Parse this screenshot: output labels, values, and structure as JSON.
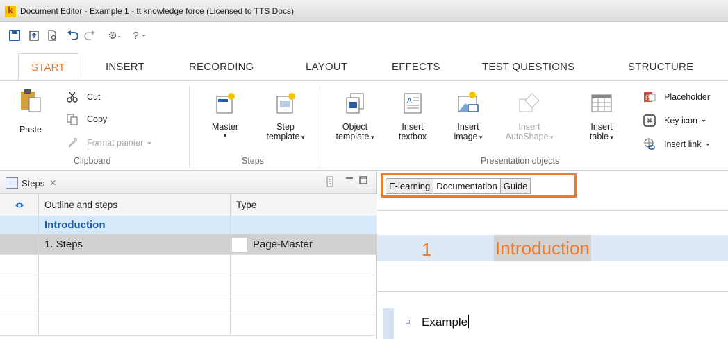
{
  "window": {
    "title": "Document Editor - Example 1 - tt knowledge force (Licensed to TTS Docs)",
    "app_icon_letter": "k"
  },
  "qat": {
    "help_label": "?"
  },
  "tabs": [
    {
      "label": "START"
    },
    {
      "label": "INSERT"
    },
    {
      "label": "RECORDING"
    },
    {
      "label": "LAYOUT"
    },
    {
      "label": "EFFECTS"
    },
    {
      "label": "TEST QUESTIONS"
    },
    {
      "label": "STRUCTURE"
    }
  ],
  "ribbon": {
    "clipboard": {
      "paste": "Paste",
      "cut": "Cut",
      "copy": "Copy",
      "format_painter": "Format painter",
      "group": "Clipboard"
    },
    "steps": {
      "master": "Master",
      "step": "Step",
      "template": "template",
      "group": "Steps"
    },
    "presentation": {
      "object": "Object",
      "object_template": "template",
      "insert_textbox_1": "Insert",
      "insert_textbox_2": "textbox",
      "insert_image_1": "Insert",
      "insert_image_2": "image",
      "insert_autoshape_1": "Insert",
      "insert_autoshape_2": "AutoShape",
      "insert_table_1": "Insert",
      "insert_table_2": "table",
      "group": "Presentation objects"
    },
    "right": {
      "placeholder": "Placeholder",
      "key_icon": "Key icon",
      "insert_link": "Insert link"
    }
  },
  "steps_panel": {
    "tab_label": "Steps",
    "columns": {
      "outline": "Outline and steps",
      "type": "Type"
    },
    "rows": [
      {
        "outline": "Introduction",
        "type": ""
      },
      {
        "outline": "1. Steps",
        "type": "Page-Master"
      }
    ]
  },
  "document": {
    "view_tabs": [
      {
        "label": "E-learning"
      },
      {
        "label": "Documentation"
      },
      {
        "label": "Guide"
      }
    ],
    "heading_number": "1",
    "heading_text": "Introduction",
    "body_text": "Example"
  },
  "colors": {
    "accent": "#f07a26",
    "selection_blue": "#d6e9fb",
    "link_blue": "#1f5aa6"
  }
}
